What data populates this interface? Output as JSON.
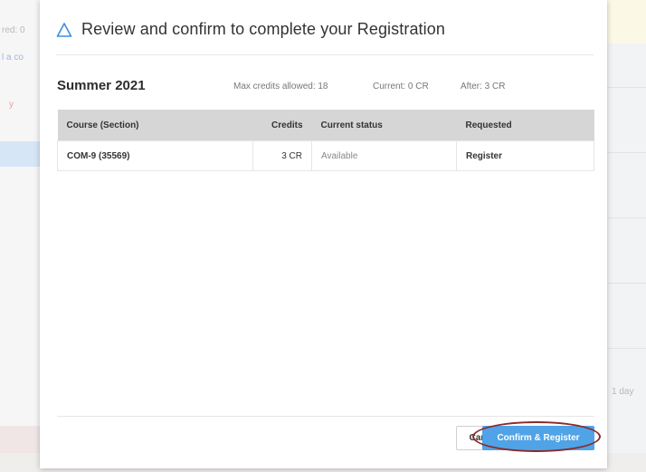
{
  "background": {
    "fragments": [
      "red: 0",
      "l a co",
      "y",
      "1 day"
    ]
  },
  "modal": {
    "title": "Review and confirm to complete your Registration",
    "icon": "delta-logo-icon"
  },
  "term": {
    "name": "Summer 2021",
    "max_credits": "Max credits allowed: 18",
    "current": "Current: 0 CR",
    "after": "After: 3 CR"
  },
  "table": {
    "headers": [
      "Course (Section)",
      "Credits",
      "Current status",
      "Requested"
    ],
    "rows": [
      {
        "course": "COM-9 (35569)",
        "credits": "3 CR",
        "status": "Available",
        "requested": "Register"
      }
    ]
  },
  "footer": {
    "cancel_label": "Cancel",
    "confirm_label": "Confirm & Register"
  },
  "colors": {
    "accent": "#4fa3e6",
    "highlight": "#8b2a2a"
  }
}
